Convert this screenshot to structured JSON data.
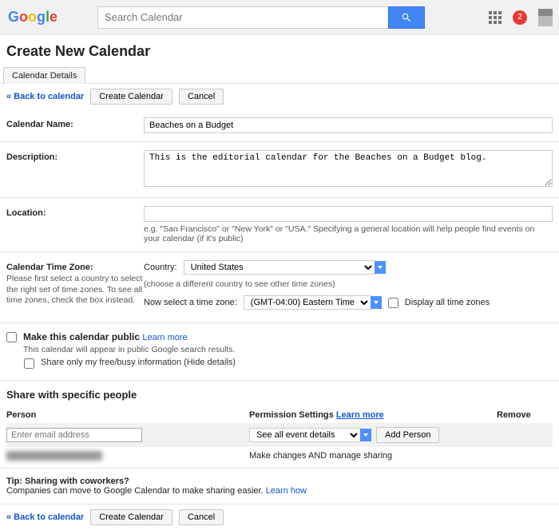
{
  "header": {
    "search_placeholder": "Search Calendar",
    "notif_count": "2"
  },
  "page_title": "Create New Calendar",
  "tab": "Calendar Details",
  "actions": {
    "back": "« Back to calendar",
    "create": "Create Calendar",
    "cancel": "Cancel"
  },
  "fields": {
    "name_label": "Calendar Name:",
    "name_value": "Beaches on a Budget",
    "desc_label": "Description:",
    "desc_value": "This is the editorial calendar for the Beaches on a Budget blog.",
    "loc_label": "Location:",
    "loc_value": "",
    "loc_hint": "e.g. \"San Francisco\" or \"New York\" or \"USA.\" Specifying a general location will help people find events on your calendar (if it's public)",
    "tz_label": "Calendar Time Zone:",
    "tz_sub": "Please first select a country to select the right set of time zones. To see all time zones, check the box instead.",
    "tz_country_label": "Country:",
    "tz_country_value": "United States",
    "tz_country_hint": "(choose a different country to see other time zones)",
    "tz_select_label": "Now select a time zone:",
    "tz_value": "(GMT-04:00) Eastern Time",
    "tz_display_all": "Display all time zones"
  },
  "public": {
    "title": "Make this calendar public",
    "learn": "Learn more",
    "sub": "This calendar will appear in public Google search results.",
    "share_only": "Share only my free/busy information (Hide details)"
  },
  "share": {
    "heading": "Share with specific people",
    "col_person": "Person",
    "col_perm": "Permission Settings",
    "col_perm_learn": "Learn more",
    "col_remove": "Remove",
    "email_placeholder": "Enter email address",
    "perm_new": "See all event details",
    "add_btn": "Add Person",
    "perm_existing": "Make changes AND manage sharing"
  },
  "tip": {
    "title": "Tip: Sharing with coworkers?",
    "text": "Companies can move to Google Calendar to make sharing easier. ",
    "link": "Learn how"
  }
}
